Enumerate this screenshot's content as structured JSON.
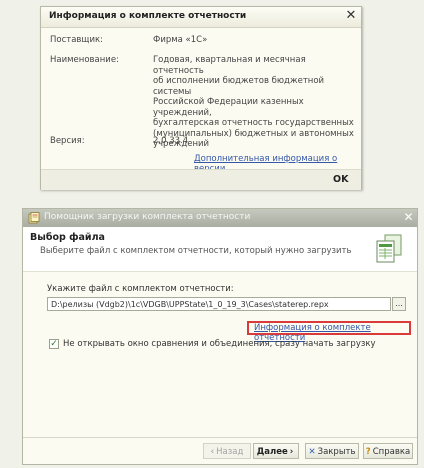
{
  "info_dialog": {
    "title": "Информация о комплекте отчетности",
    "supplier_label": "Поставщик:",
    "supplier_value": "Фирма «1С»",
    "name_label": "Наименование:",
    "name_lines": [
      "Годовая, квартальная и месячная отчетность",
      "об исполнении бюджетов бюджетной системы",
      "Российской Федерации казенных учреждений,",
      "бухгалтерская отчетность государственных",
      "(муниципальных) бюджетных и автономных",
      "учреждений"
    ],
    "version_label": "Версия:",
    "version_value": "2.0.33.4",
    "version_link": "Дополнительная информация о версии",
    "ok_label": "OK"
  },
  "wizard_dialog": {
    "title": "Помощник загрузки комплекта отчетности",
    "step_title": "Выбор файла",
    "step_subtitle": "Выберите файл с комплектом отчетности, который нужно загрузить",
    "file_label": "Укажите файл с комплектом отчетности:",
    "file_path": "D:\\релизы (Vdgb2)\\1c\\VDGB\\UPPState\\1_0_19_3\\Cases\\staterep.repx",
    "browse_label": "...",
    "info_link": "Информация о комплекте отчетности",
    "checkbox_checked": true,
    "checkbox_label": "Не открывать окно сравнения и объединения, сразу начать загрузку",
    "buttons": {
      "back": "Назад",
      "next": "Далее",
      "close": "Закрыть",
      "help": "Справка"
    },
    "colors": {
      "highlight": "#d93a3a",
      "link": "#3557a8"
    }
  }
}
